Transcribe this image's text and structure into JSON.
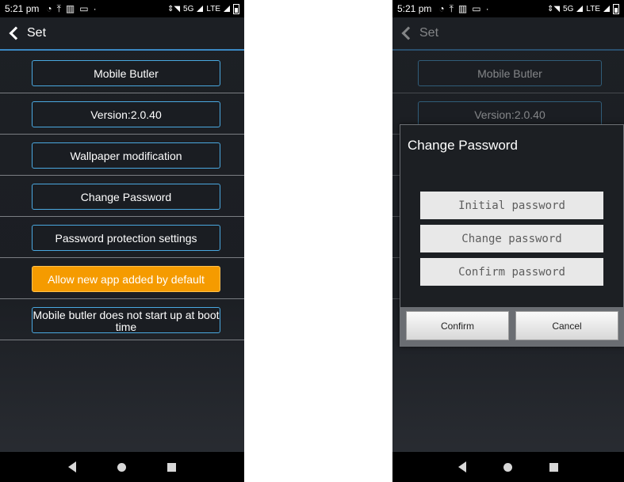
{
  "status_bar": {
    "time": "5:21 pm",
    "network": "5G",
    "lte": "LTE",
    "icons": [
      "alarm-icon",
      "upload-icon",
      "notes-icon",
      "sim-icon",
      "dot-icon",
      "wifi-icon",
      "signal-icon",
      "battery-icon"
    ]
  },
  "header": {
    "title": "Set"
  },
  "settings": [
    {
      "label": "Mobile Butler"
    },
    {
      "label": "Version:2.0.40"
    },
    {
      "label": "Wallpaper modification"
    },
    {
      "label": "Change Password"
    },
    {
      "label": "Password protection settings"
    },
    {
      "label": "Allow new app added by default",
      "highlighted": true
    },
    {
      "label": "Mobile butler does not start up at boot time"
    }
  ],
  "dialog": {
    "title": "Change Password",
    "initial_placeholder": "Initial password",
    "change_placeholder": "Change password",
    "confirm_placeholder": "Confirm password",
    "confirm_label": "Confirm",
    "cancel_label": "Cancel"
  },
  "colors": {
    "accent": "#4aa8e0",
    "highlight": "#f59b00",
    "background": "#1d2025"
  }
}
